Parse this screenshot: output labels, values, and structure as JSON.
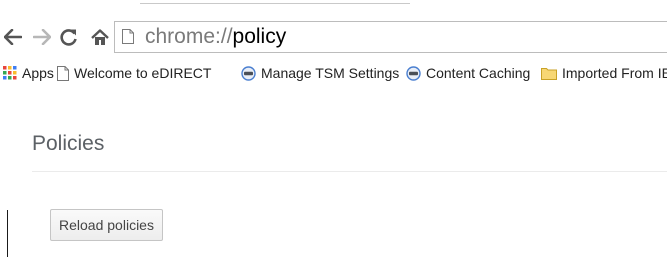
{
  "browser": {
    "address_bar": {
      "scheme": "chrome://",
      "path": "policy"
    },
    "toolbar_icons": [
      "back-arrow-icon",
      "forward-arrow-icon",
      "reload-icon",
      "home-icon"
    ],
    "bookmarks": [
      {
        "label": "Apps",
        "icon": "apps-grid-icon"
      },
      {
        "label": "Welcome to eDIRECT",
        "icon": "page-icon"
      },
      {
        "label": "Manage TSM Settings",
        "icon": "globe-icon"
      },
      {
        "label": "Content Caching",
        "icon": "globe-icon"
      },
      {
        "label": "Imported From IE",
        "icon": "folder-icon"
      }
    ]
  },
  "page": {
    "title": "Policies",
    "reload_button_label": "Reload policies"
  },
  "colors": {
    "apps_grid": [
      "#e8453c",
      "#f9bb2d",
      "#3e7ef4",
      "#34a853"
    ],
    "folder": "#f2c94c",
    "globe": "#4a7fd0"
  }
}
